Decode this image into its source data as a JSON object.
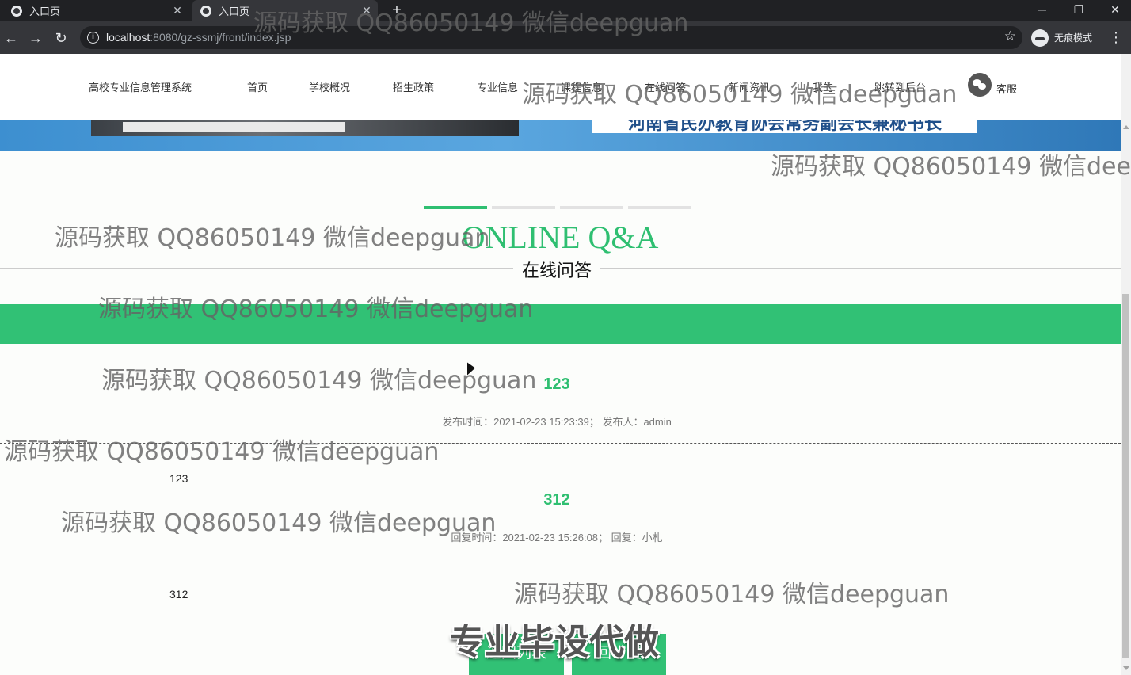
{
  "browser": {
    "tabs": [
      {
        "title": "入口页",
        "active": false
      },
      {
        "title": "入口页",
        "active": true
      }
    ],
    "new_tab": "+",
    "url_host": "localhost",
    "url_path": ":8080/gz-ssmj/front/index.jsp",
    "incognito_label": "无痕模式",
    "window_controls": [
      "minimize",
      "restore",
      "close"
    ]
  },
  "site": {
    "brand": "高校专业信息管理系统",
    "nav": [
      "首页",
      "学校概况",
      "招生政策",
      "专业信息",
      "课程信息",
      "在线问答",
      "新闻资讯",
      "我的",
      "跳转到后台"
    ],
    "kefu": "客服"
  },
  "banner": {
    "caption": "河南省民办教育协会常务副会长兼秘书长"
  },
  "carousel": {
    "pages": 4,
    "active_index": 0
  },
  "section": {
    "title_en": "ONLINE Q&A",
    "title_cn": "在线问答"
  },
  "question": {
    "title": "123",
    "meta": "发布时间：2021-02-23 15:23:39；  发布人：admin",
    "body": "123"
  },
  "reply": {
    "title": "312",
    "meta": "回复时间：2021-02-23 15:26:08；  回复：小札",
    "body": "312"
  },
  "buttons": {
    "back": "返回列表",
    "reply": "回　复"
  },
  "watermarks": {
    "text": "源码获取 QQ86050149 微信deepguan",
    "big": "专业毕设代做"
  },
  "colors": {
    "accent": "#2fbf71",
    "chrome_dark": "#202124",
    "chrome_bar": "#35363a"
  }
}
